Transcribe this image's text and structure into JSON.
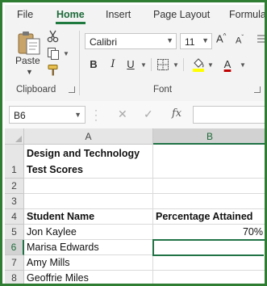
{
  "tabs": [
    "File",
    "Home",
    "Insert",
    "Page Layout",
    "Formulas"
  ],
  "active_tab": "Home",
  "clipboard": {
    "paste_label": "Paste",
    "group_label": "Clipboard"
  },
  "font": {
    "name": "Calibri",
    "size": "11",
    "group_label": "Font",
    "bold": "B",
    "italic": "I",
    "underline": "U",
    "grow_symbol": "A",
    "shrink_symbol": "A",
    "font_color_letter": "A",
    "highlight_color": "#ffff00",
    "font_color": "#c00000"
  },
  "formula_bar": {
    "name_box": "B6",
    "fx_label": "fx",
    "content": ""
  },
  "grid": {
    "columns": [
      "A",
      "B"
    ],
    "selected_column": "B",
    "selected_row": "6",
    "rows": [
      {
        "num": "1",
        "a": "Design and Technology",
        "a2": "Test Scores",
        "b": "",
        "bold": true
      },
      {
        "num": "2",
        "a": "",
        "b": ""
      },
      {
        "num": "3",
        "a": "",
        "b": ""
      },
      {
        "num": "4",
        "a": "Student Name",
        "b": "Percentage Attained",
        "bold": true
      },
      {
        "num": "5",
        "a": "Jon Kaylee",
        "b": "70%"
      },
      {
        "num": "6",
        "a": "Marisa Edwards",
        "b": ""
      },
      {
        "num": "7",
        "a": "Amy Mills",
        "b": ""
      },
      {
        "num": "8",
        "a": "Geoffrie Miles",
        "b": ""
      }
    ]
  },
  "colors": {
    "accent": "#217346",
    "frame": "#2e7d32"
  }
}
